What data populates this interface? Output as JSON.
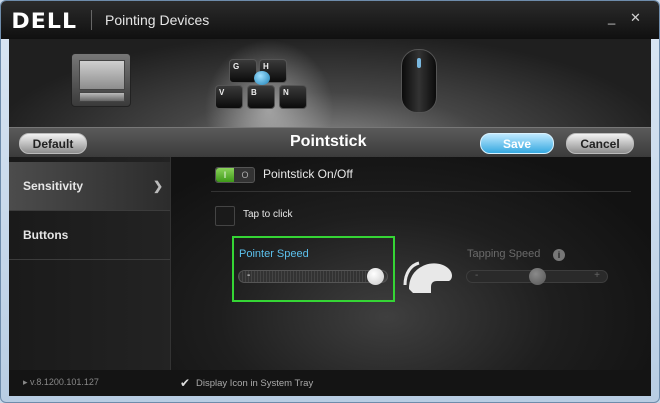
{
  "window": {
    "brand": "DELL",
    "title": "Pointing Devices",
    "minimize": "_",
    "close": "✕"
  },
  "hero": {
    "keyboard_keys": [
      "G",
      "H",
      "V",
      "B",
      "N"
    ],
    "mouse_caption": ""
  },
  "toolbar": {
    "default_label": "Default",
    "title": "Pointstick",
    "save_label": "Save",
    "cancel_label": "Cancel"
  },
  "sidebar": {
    "items": [
      {
        "label": "Sensitivity",
        "active": true
      },
      {
        "label": "Buttons",
        "active": false
      }
    ]
  },
  "content": {
    "toggle_on": "I",
    "toggle_off": "O",
    "toggle_label": "Pointstick On/Off",
    "tap_to_click": "Tap to click",
    "pointer_speed": {
      "label": "Pointer Speed",
      "minus": "-",
      "plus": "+",
      "value_percent": 98
    },
    "tapping_speed": {
      "label": "Tapping Speed",
      "minus": "-",
      "plus": "+",
      "value_percent": 50
    },
    "info_glyph": "i"
  },
  "footer": {
    "version": "v.8.1200.101.127",
    "tray_label": "Display Icon in System Tray",
    "tray_checked": true
  },
  "colors": {
    "accent": "#35a8e0",
    "highlight": "#35d535",
    "pointer_label": "#5cc0ec"
  }
}
